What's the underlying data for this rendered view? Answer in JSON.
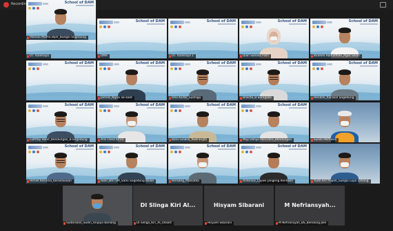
{
  "app": {
    "recording_label": "Recording",
    "brand_text": "School of DAM"
  },
  "colors": {
    "dam_blue": "#2e4d7b",
    "water": "#5f9fc8",
    "name_bg": "#000000",
    "mic_muted": "#e14b3b",
    "active_speaker": "#e6e14a"
  },
  "participants": [
    {
      "name": "DT. Kalimaya",
      "view": "branded",
      "skin": "#b6825f",
      "shirt": "#4a6076",
      "variant": "none"
    },
    {
      "name": "DMA",
      "view": "branded",
      "skin": "#b6825f",
      "shirt": "#4a6076",
      "variant": "none"
    },
    {
      "name": "DT. Kalimaya 1",
      "view": "branded",
      "skin": "#b6825f",
      "shirt": "#4a6076",
      "variant": "none"
    },
    {
      "name": "Dian Sanasa Putri",
      "view": "branded",
      "skin": "#d8b09a",
      "shirt": "#e7d3c6",
      "variant": "hijab-mask"
    },
    {
      "name": "Ibrahim Ramadhan_Agus Sikan",
      "view": "branded",
      "skin": "#b6825f",
      "shirt": "#f3f3f3",
      "variant": "person"
    },
    {
      "name": "",
      "view": "branded",
      "skin": "#b6825f",
      "shirt": "#4a6076",
      "variant": "none"
    },
    {
      "name": "Jamels_Ngasi Sk-kaet",
      "view": "branded",
      "skin": "#b6825f",
      "shirt": "#2f3f52",
      "variant": "person"
    },
    {
      "name": "Isha Kartik_Sulmigu",
      "view": "branded",
      "skin": "#b47d58",
      "shirt": "#5a6a78",
      "variant": "glasses"
    },
    {
      "name": "Briesta_B.Sarngaka",
      "view": "branded",
      "skin": "#b47d58",
      "shirt": "#d9d9d9",
      "variant": "glasses"
    },
    {
      "name": "Hendrik_Karanin Sngedung",
      "view": "branded",
      "skin": "#b6825f",
      "shirt": "#6c7b86",
      "variant": "person"
    },
    {
      "name": "Luthfiqi Hanif_Bendungan_B.Sngedung",
      "view": "branded",
      "skin": "#b6825f",
      "shirt": "#3c4e62",
      "variant": "glasses"
    },
    {
      "name": "Aris Freez Kirim",
      "view": "branded",
      "skin": "#c59373",
      "shirt": "#e6e6e6",
      "variant": "mask",
      "active": true
    },
    {
      "name": "Baru Ginalia_Nubrangto",
      "view": "branded",
      "skin": "#b6825f",
      "shirt": "#c9b896",
      "variant": "person"
    },
    {
      "name": "Muji Dehyo Pancsero_Bendungan",
      "view": "branded",
      "skin": "#b6825f",
      "shirt": "#e3e3e3",
      "variant": "person"
    },
    {
      "name": "Susilo Moltiwan",
      "view": "camera",
      "skin": "#b6825f",
      "shirt": "#1e5fa8",
      "variant": "helmet-mask"
    },
    {
      "name": "Heniel Kesuma_Keramasaan",
      "view": "branded",
      "skin": "#b6825f",
      "shirt": "#4f6a8a",
      "variant": "glasses"
    },
    {
      "name": "Iwan Jefri SM_Sarki Sngedung Baian",
      "view": "branded",
      "skin": "#b6825f",
      "shirt": "#314255",
      "variant": "person"
    },
    {
      "name": "Hersang_Matsatka",
      "view": "branded",
      "skin": "#c59373",
      "shirt": "#5b6a74",
      "variant": "mask"
    },
    {
      "name": "Antonius_Lajiwe Jangeng Kentwali",
      "view": "branded",
      "skin": "#b47d58",
      "shirt": "#2b2b2b",
      "variant": "person"
    },
    {
      "name": "Yudo Arif Pupoti_Sungai Luyo Lahang",
      "view": "camera",
      "skin": "#b6825f",
      "shirt": "#2f5d8f",
      "variant": "mask"
    },
    {
      "name": "Pameal Muthu Bijer_Bungai Sngedung",
      "view": "branded",
      "skin": "#b6825f",
      "shirt": "#3a4b5d",
      "variant": "person"
    }
  ],
  "bottom_tiles": [
    {
      "name": "Sudarsalin_Sudin_Unjaya Barlang",
      "display": "",
      "type": "video"
    },
    {
      "name": "DI Slinga_Kiri_Al_Uilaart",
      "display": "DI Slinga Kiri Al...",
      "type": "name"
    },
    {
      "name": "Hisyam Sibarani",
      "display": "Hisyam Sibarani",
      "type": "name"
    },
    {
      "name": "M Nefriansyah_BS_Bendung Jole",
      "display": "M Nefriansyah...",
      "type": "name"
    }
  ]
}
